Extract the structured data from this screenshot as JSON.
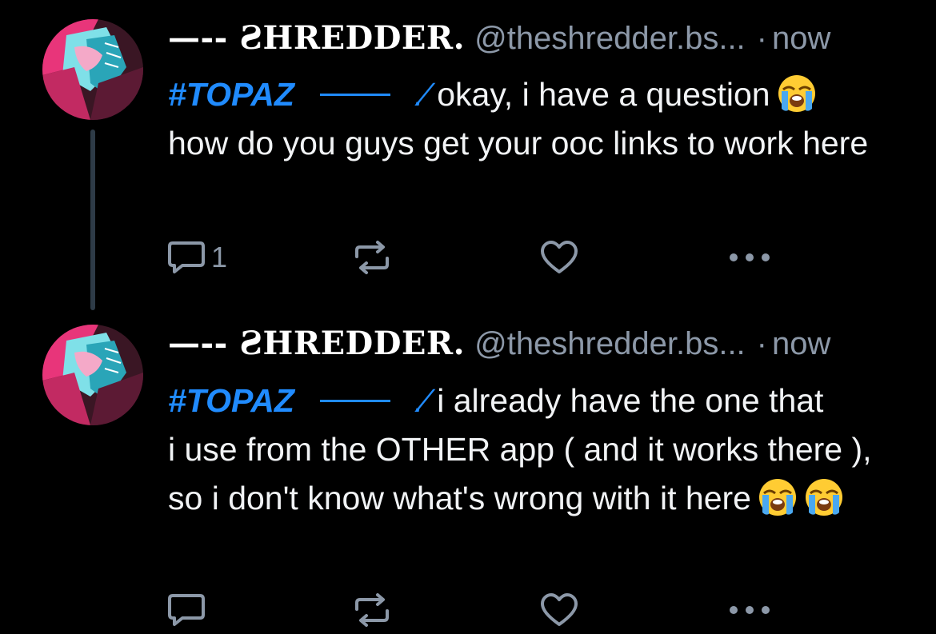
{
  "posts": [
    {
      "author": {
        "display_name_prefix": "—-- ",
        "display_name": "ꙄHREDDER.",
        "handle": "@theshredder.bs...",
        "separator": "·",
        "time": "now"
      },
      "hashtag": "#TOPAZ",
      "mark": ".⁄",
      "text": "okay, i have a question",
      "text_continued": "how do you guys get your ooc links to work here",
      "emoji_count": 1,
      "emoji_name": "loudly-crying-face",
      "reply_count": "1"
    },
    {
      "author": {
        "display_name_prefix": "—-- ",
        "display_name": "ꙄHREDDER.",
        "handle": "@theshredder.bs...",
        "separator": "·",
        "time": "now"
      },
      "hashtag": "#TOPAZ",
      "mark": ".⁄",
      "text": "i already have the one that",
      "text_continued": "i use from the OTHER app ( and it works there ), so i don't know what's wrong with it here",
      "emoji_count": 2,
      "emoji_name": "loudly-crying-face",
      "reply_count": ""
    }
  ],
  "colors": {
    "background": "#000000",
    "text": "#f1f3f5",
    "muted": "#8c98a8",
    "accent": "#208bfe",
    "thread_line": "#2e3b47"
  },
  "icons": {
    "reply": "speech-bubble-icon",
    "repost": "repost-arrows-icon",
    "like": "heart-icon",
    "more": "ellipsis-icon"
  }
}
